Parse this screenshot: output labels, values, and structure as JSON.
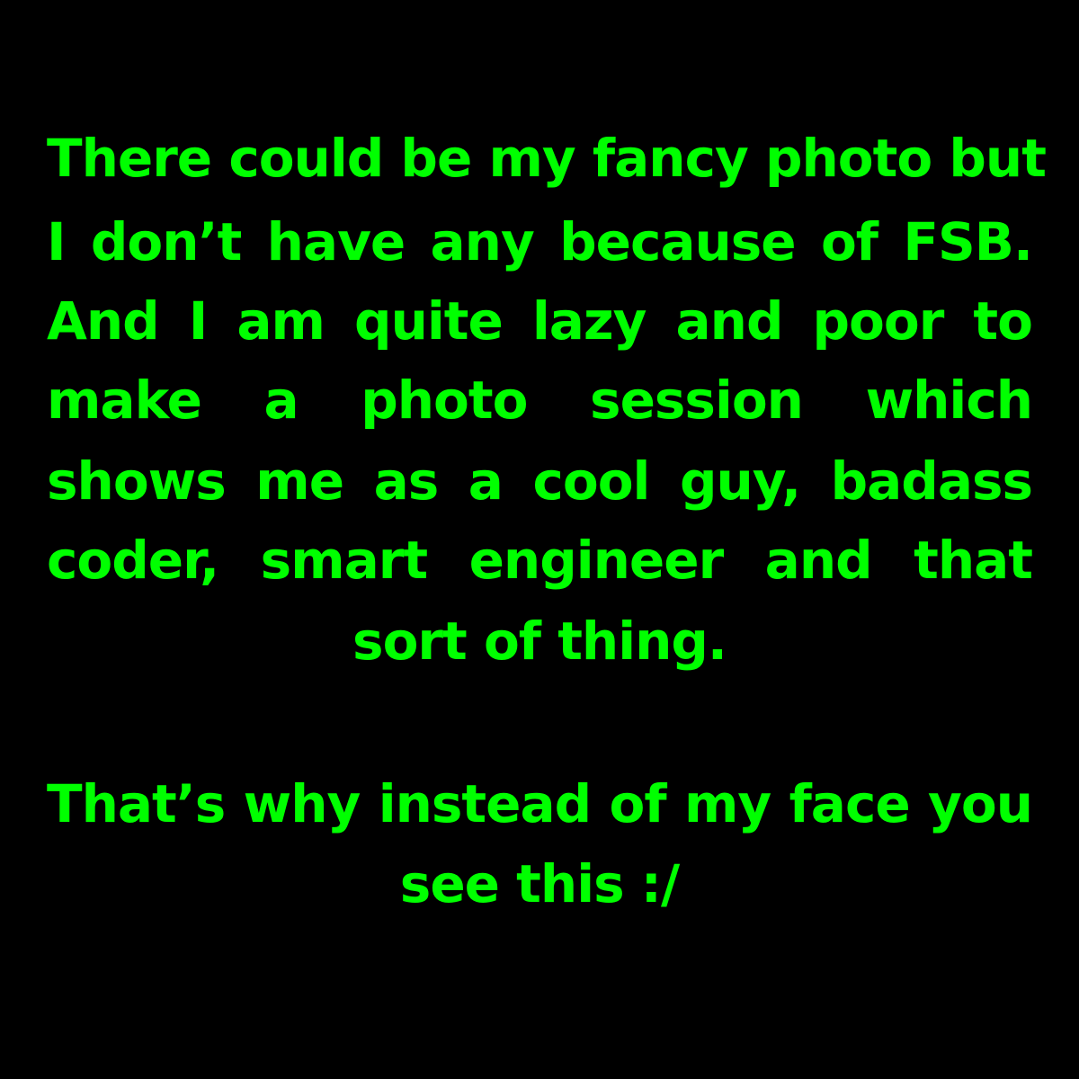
{
  "text_color": "#00ff00",
  "background_color": "#000000",
  "paragraph1": {
    "lines": [
      "There could be my fancy photo but",
      "I don’t have any because of FSB.",
      "And I am quite lazy and poor to",
      "make a photo session which",
      "shows me as a cool guy, badass",
      "coder, smart engineer and that",
      "sort of thing."
    ]
  },
  "paragraph2": {
    "lines": [
      "That’s why instead of my face you",
      "see this :/"
    ]
  }
}
